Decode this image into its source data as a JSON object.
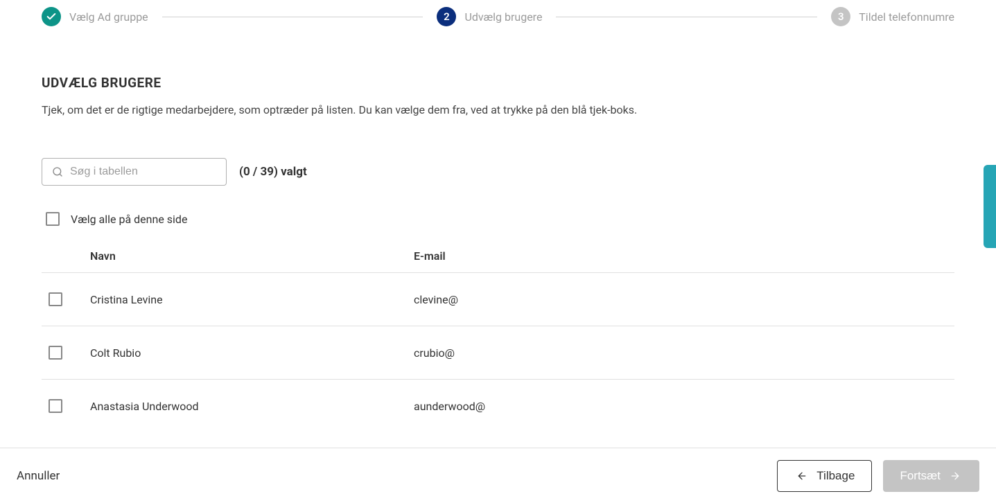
{
  "stepper": {
    "steps": [
      {
        "label": "Vælg Ad gruppe",
        "state": "completed"
      },
      {
        "label": "Udvælg brugere",
        "state": "active",
        "number": "2"
      },
      {
        "label": "Tildel telefonnumre",
        "state": "pending",
        "number": "3"
      }
    ]
  },
  "section": {
    "title": "UDVÆLG BRUGERE",
    "description": "Tjek, om det er de rigtige medarbejdere, som optræder på listen. Du kan vælge dem fra, ved at trykke på den blå tjek-boks."
  },
  "search": {
    "placeholder": "Søg i tabellen"
  },
  "selection": {
    "count_prefix": "(0 / 39)",
    "count_suffix": "valgt"
  },
  "select_all_label": "Vælg alle på denne side",
  "table": {
    "headers": {
      "name": "Navn",
      "email": "E-mail"
    },
    "rows": [
      {
        "name": "Cristina Levine",
        "email": "clevine@"
      },
      {
        "name": "Colt Rubio",
        "email": "crubio@"
      },
      {
        "name": "Anastasia Underwood",
        "email": "aunderwood@"
      }
    ]
  },
  "footer": {
    "cancel": "Annuller",
    "back": "Tilbage",
    "continue": "Fortsæt"
  }
}
